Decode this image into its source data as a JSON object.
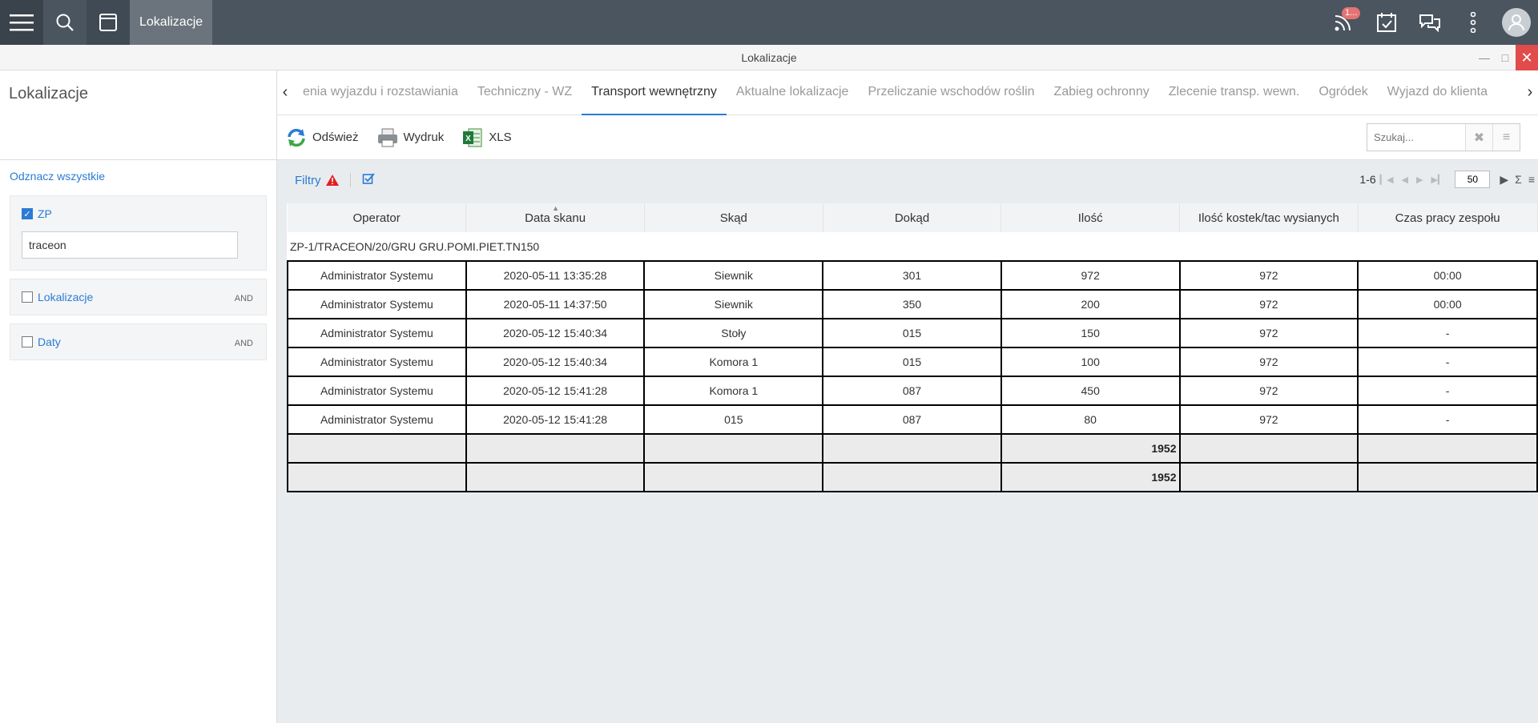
{
  "topbar": {
    "tab_label": "Lokalizacje",
    "notification_count": "1..."
  },
  "window": {
    "title": "Lokalizacje"
  },
  "left": {
    "title": "Lokalizacje",
    "deselect_all": "Odznacz wszystkie",
    "filters": [
      {
        "label": "ZP",
        "checked": true,
        "value": "traceon"
      },
      {
        "label": "Lokalizacje",
        "checked": false,
        "op": "AND"
      },
      {
        "label": "Daty",
        "checked": false,
        "op": "AND"
      }
    ]
  },
  "tabs": [
    "enia wyjazdu i rozstawiania",
    "Techniczny - WZ",
    "Transport wewnętrzny",
    "Aktualne lokalizacje",
    "Przeliczanie wschodów roślin",
    "Zabieg ochronny",
    "Zlecenie transp. wewn.",
    "Ogródek",
    "Wyjazd do klienta"
  ],
  "active_tab_index": 2,
  "toolbar": {
    "refresh": "Odśwież",
    "print": "Wydruk",
    "xls": "XLS",
    "search_placeholder": "Szukaj..."
  },
  "filterbar": {
    "filters_label": "Filtry",
    "range": "1-6",
    "page_size": "50"
  },
  "table": {
    "columns": [
      "Operator",
      "Data skanu",
      "Skąd",
      "Dokąd",
      "Ilość",
      "Ilość kostek/tac wysianych",
      "Czas pracy zespołu"
    ],
    "group": "ZP-1/TRACEON/20/GRU GRU.POMI.PIET.TN150",
    "rows": [
      [
        "Administrator Systemu",
        "2020-05-11 13:35:28",
        "Siewnik",
        "301",
        "972",
        "972",
        "00:00"
      ],
      [
        "Administrator Systemu",
        "2020-05-11 14:37:50",
        "Siewnik",
        "350",
        "200",
        "972",
        "00:00"
      ],
      [
        "Administrator Systemu",
        "2020-05-12 15:40:34",
        "Stoły",
        "015",
        "150",
        "972",
        "-"
      ],
      [
        "Administrator Systemu",
        "2020-05-12 15:40:34",
        "Komora 1",
        "015",
        "100",
        "972",
        "-"
      ],
      [
        "Administrator Systemu",
        "2020-05-12 15:41:28",
        "Komora 1",
        "087",
        "450",
        "972",
        "-"
      ],
      [
        "Administrator Systemu",
        "2020-05-12 15:41:28",
        "015",
        "087",
        "80",
        "972",
        "-"
      ]
    ],
    "totals": [
      "1952",
      "1952"
    ]
  }
}
